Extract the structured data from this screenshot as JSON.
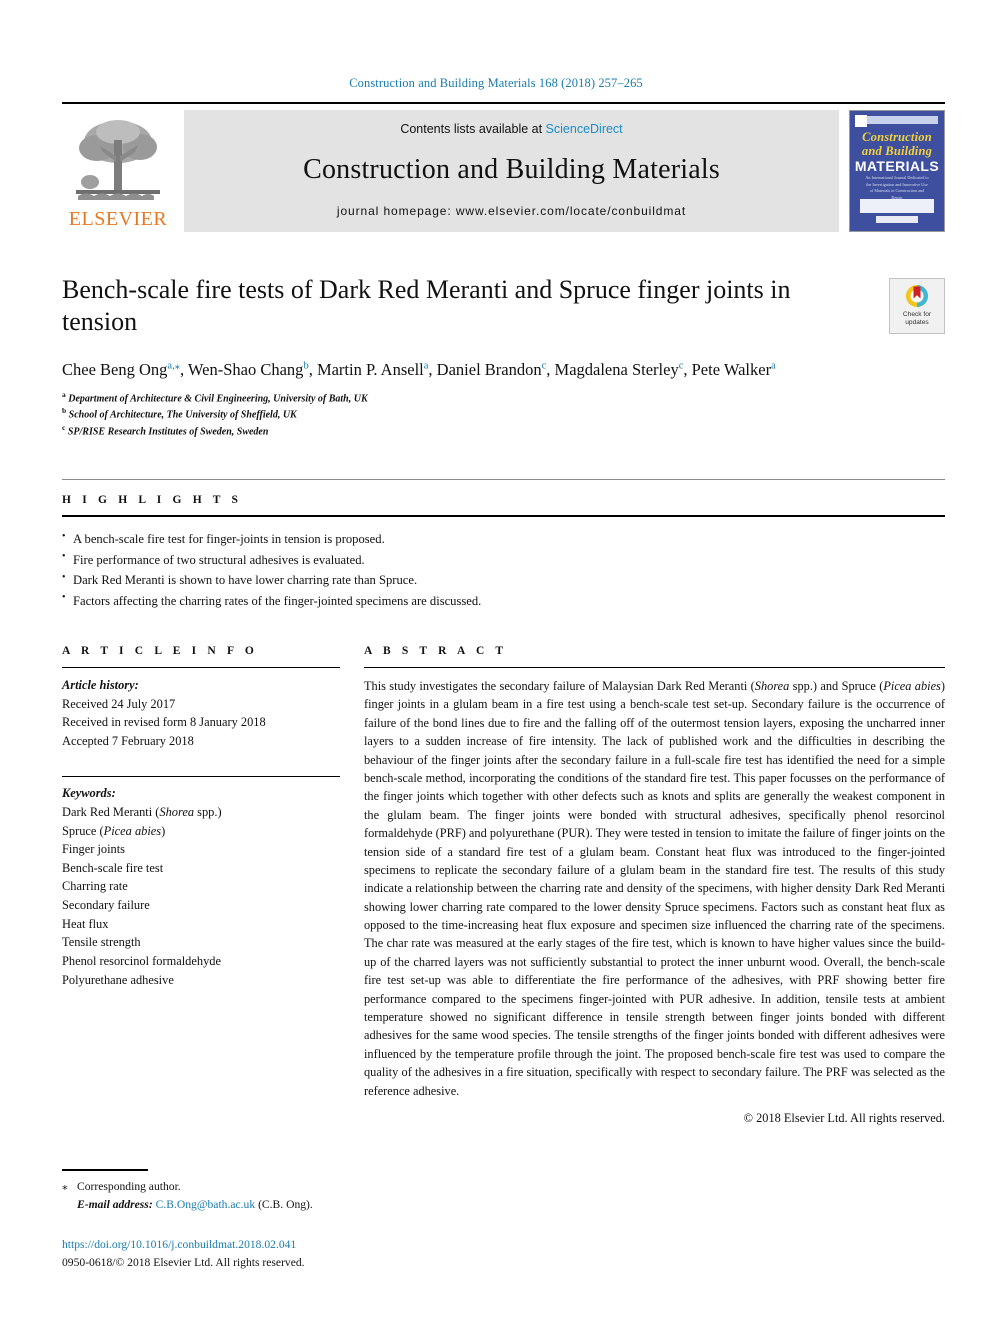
{
  "running_head": "Construction and Building Materials 168 (2018) 257–265",
  "masthead": {
    "elsevier_wordmark": "ELSEVIER",
    "contents_prefix": "Contents lists available at ",
    "sciencedirect": "ScienceDirect",
    "journal_name": "Construction and Building Materials",
    "homepage": "journal homepage: www.elsevier.com/locate/conbuildmat",
    "cover": {
      "line1": "Construction",
      "line2": "and Building",
      "line3": "MATERIALS",
      "blurb": "An International Journal Dedicated to the Investigation and Innovative Use of Materials in Construction and Repair"
    },
    "colors": {
      "link_blue": "#1a8cc8",
      "elsevier_orange": "#e87722",
      "band_gray": "#e3e3e3",
      "cover_blue": "#3d4f9e",
      "cover_yellow": "#f2d23b"
    }
  },
  "article": {
    "title": "Bench-scale fire tests of Dark Red Meranti and Spruce finger joints in tension",
    "crossmark_line1": "Check for",
    "crossmark_line2": "updates",
    "authors": [
      {
        "name": "Chee Beng Ong",
        "sup": "a,⁎"
      },
      {
        "name": "Wen-Shao Chang",
        "sup": "b"
      },
      {
        "name": "Martin P. Ansell",
        "sup": "a"
      },
      {
        "name": "Daniel Brandon",
        "sup": "c"
      },
      {
        "name": "Magdalena Sterley",
        "sup": "c"
      },
      {
        "name": "Pete Walker",
        "sup": "a"
      }
    ],
    "affiliations": [
      {
        "mark": "a",
        "text": "Department of Architecture & Civil Engineering, University of Bath, UK"
      },
      {
        "mark": "b",
        "text": "School of Architecture, The University of Sheffield, UK"
      },
      {
        "mark": "c",
        "text": "SP/RISE Research Institutes of Sweden, Sweden"
      }
    ]
  },
  "highlights": {
    "heading": "H I G H L I G H T S",
    "items": [
      "A bench-scale fire test for finger-joints in tension is proposed.",
      "Fire performance of two structural adhesives is evaluated.",
      "Dark Red Meranti is shown to have lower charring rate than Spruce.",
      "Factors affecting the charring rates of the finger-jointed specimens are discussed."
    ]
  },
  "article_info": {
    "heading": "A R T I C L E   I N F O",
    "history_title": "Article history:",
    "history": [
      "Received 24 July 2017",
      "Received in revised form 8 January 2018",
      "Accepted 7 February 2018"
    ],
    "keywords_title": "Keywords:",
    "keywords": [
      "Dark Red Meranti (Shorea spp.)",
      "Spruce (Picea abies)",
      "Finger joints",
      "Bench-scale fire test",
      "Charring rate",
      "Secondary failure",
      "Heat flux",
      "Tensile strength",
      "Phenol resorcinol formaldehyde",
      "Polyurethane adhesive"
    ]
  },
  "abstract": {
    "heading": "A B S T R A C T",
    "text": "This study investigates the secondary failure of Malaysian Dark Red Meranti (Shorea spp.) and Spruce (Picea abies) finger joints in a glulam beam in a fire test using a bench-scale test set-up. Secondary failure is the occurrence of failure of the bond lines due to fire and the falling off of the outermost tension layers, exposing the uncharred inner layers to a sudden increase of fire intensity. The lack of published work and the difficulties in describing the behaviour of the finger joints after the secondary failure in a full-scale fire test has identified the need for a simple bench-scale method, incorporating the conditions of the standard fire test. This paper focusses on the performance of the finger joints which together with other defects such as knots and splits are generally the weakest component in the glulam beam. The finger joints were bonded with structural adhesives, specifically phenol resorcinol formaldehyde (PRF) and polyurethane (PUR). They were tested in tension to imitate the failure of finger joints on the tension side of a standard fire test of a glulam beam. Constant heat flux was introduced to the finger-jointed specimens to replicate the secondary failure of a glulam beam in the standard fire test. The results of this study indicate a relationship between the charring rate and density of the specimens, with higher density Dark Red Meranti showing lower charring rate compared to the lower density Spruce specimens. Factors such as constant heat flux as opposed to the time-increasing heat flux exposure and specimen size influenced the charring rate of the specimens. The char rate was measured at the early stages of the fire test, which is known to have higher values since the build-up of the charred layers was not sufficiently substantial to protect the inner unburnt wood. Overall, the bench-scale fire test set-up was able to differentiate the fire performance of the adhesives, with PRF showing better fire performance compared to the specimens finger-jointed with PUR adhesive. In addition, tensile tests at ambient temperature showed no significant difference in tensile strength between finger joints bonded with different adhesives for the same wood species. The tensile strengths of the finger joints bonded with different adhesives were influenced by the temperature profile through the joint. The proposed bench-scale fire test was used to compare the quality of the adhesives in a fire situation, specifically with respect to secondary failure. The PRF was selected as the reference adhesive.",
    "copyright": "© 2018 Elsevier Ltd. All rights reserved."
  },
  "footer": {
    "corresponding_author": "Corresponding author.",
    "email_label": "E-mail address:",
    "email": "C.B.Ong@bath.ac.uk",
    "email_owner": "(C.B. Ong).",
    "doi": "https://doi.org/10.1016/j.conbuildmat.2018.02.041",
    "issn_line": "0950-0618/© 2018 Elsevier Ltd. All rights reserved."
  }
}
